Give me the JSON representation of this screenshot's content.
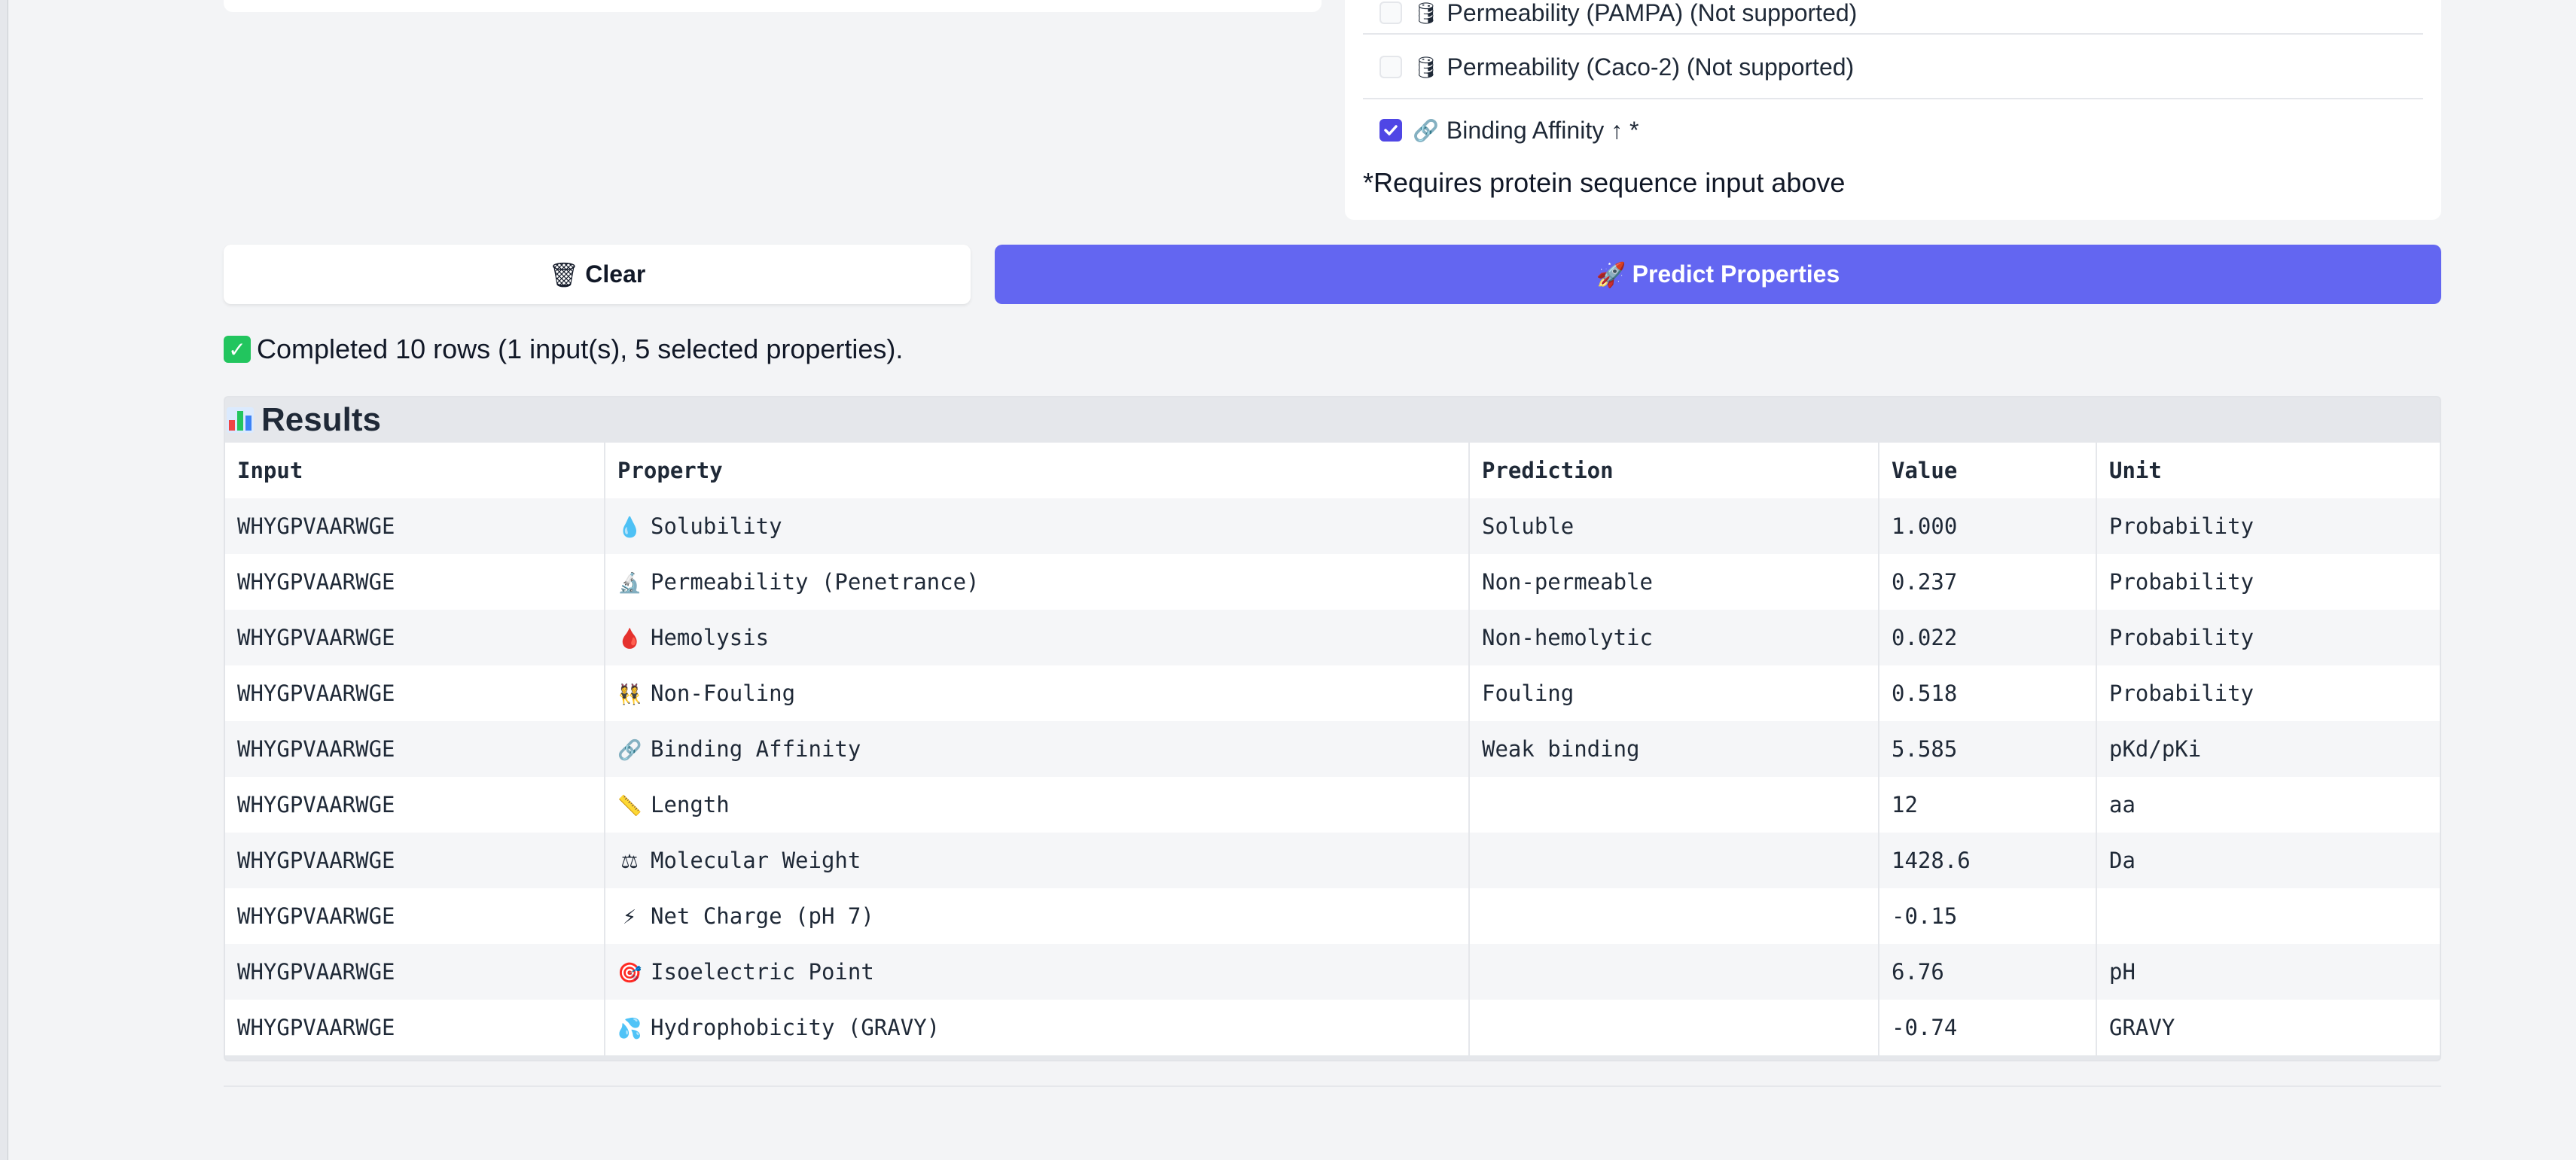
{
  "options": {
    "items": [
      {
        "icon": "🛢",
        "label": "Permeability (PAMPA) (Not supported)",
        "checked": false
      },
      {
        "icon": "🛢",
        "label": "Permeability (Caco-2) (Not supported)",
        "checked": false
      },
      {
        "icon": "🔗",
        "label": "Binding Affinity ↑ *",
        "checked": true
      }
    ],
    "note": "*Requires protein sequence input above"
  },
  "buttons": {
    "clear_label": "Clear",
    "clear_icon": "🗑",
    "predict_label": "Predict Properties",
    "predict_icon": "🚀"
  },
  "status": {
    "text": "Completed 10 rows (1 input(s), 5 selected properties)."
  },
  "results": {
    "title": "Results",
    "columns": [
      "Input",
      "Property",
      "Prediction",
      "Value",
      "Unit"
    ],
    "rows": [
      {
        "input": "WHYGPVAARWGE",
        "icon": "💧",
        "property": "Solubility",
        "prediction": "Soluble",
        "value": "1.000",
        "unit": "Probability"
      },
      {
        "input": "WHYGPVAARWGE",
        "icon": "🔬",
        "property": "Permeability (Penetrance)",
        "prediction": "Non-permeable",
        "value": "0.237",
        "unit": "Probability"
      },
      {
        "input": "WHYGPVAARWGE",
        "icon": "🩸",
        "property": "Hemolysis",
        "prediction": "Non-hemolytic",
        "value": "0.022",
        "unit": "Probability"
      },
      {
        "input": "WHYGPVAARWGE",
        "icon": "👯",
        "property": "Non-Fouling",
        "prediction": "Fouling",
        "value": "0.518",
        "unit": "Probability"
      },
      {
        "input": "WHYGPVAARWGE",
        "icon": "🔗",
        "property": "Binding Affinity",
        "prediction": "Weak binding",
        "value": "5.585",
        "unit": "pKd/pKi"
      },
      {
        "input": "WHYGPVAARWGE",
        "icon": "📏",
        "property": "Length",
        "prediction": "",
        "value": "12",
        "unit": "aa"
      },
      {
        "input": "WHYGPVAARWGE",
        "icon": "⚖",
        "property": "Molecular Weight",
        "prediction": "",
        "value": "1428.6",
        "unit": "Da"
      },
      {
        "input": "WHYGPVAARWGE",
        "icon": "⚡",
        "property": "Net Charge (pH 7)",
        "prediction": "",
        "value": "-0.15",
        "unit": ""
      },
      {
        "input": "WHYGPVAARWGE",
        "icon": "🎯",
        "property": "Isoelectric Point",
        "prediction": "",
        "value": "6.76",
        "unit": "pH"
      },
      {
        "input": "WHYGPVAARWGE",
        "icon": "💦",
        "property": "Hydrophobicity (GRAVY)",
        "prediction": "",
        "value": "-0.74",
        "unit": "GRAVY"
      }
    ]
  },
  "colors": {
    "accent": "#6366f1",
    "checkbox": "#4f46e5",
    "success": "#22c55e"
  }
}
